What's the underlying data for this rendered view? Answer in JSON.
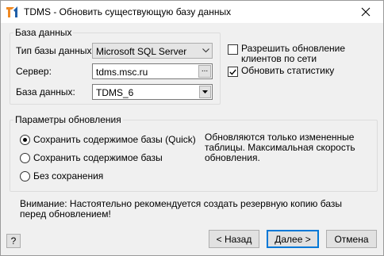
{
  "window": {
    "title": "TDMS - Обновить существующую базу данных"
  },
  "database_group": {
    "legend": "База данных",
    "type_label": "Тип базы данных:",
    "type_value": "Microsoft SQL Server",
    "server_label": "Сервер:",
    "server_value": "tdms.msc.ru",
    "browse_label": "...",
    "db_label": "База данных:",
    "db_value": "TDMS_6"
  },
  "options": {
    "allow_update": {
      "label": "Разрешить обновление клиентов по сети",
      "checked": false
    },
    "update_stats": {
      "label": "Обновить статистику",
      "checked": true
    }
  },
  "update_group": {
    "legend": "Параметры обновления",
    "modes": [
      {
        "label": "Сохранить содержимое базы (Quick)",
        "selected": true
      },
      {
        "label": "Сохранить содержимое базы",
        "selected": false
      },
      {
        "label": "Без сохранения",
        "selected": false
      }
    ],
    "description": "Обновляются только измененные таблицы. Максимальная скорость обновления."
  },
  "warning": "Внимание: Настоятельно рекомендуется создать резервную копию базы перед обновлением!",
  "buttons": {
    "help": "?",
    "back": "< Назад",
    "next": "Далее >",
    "cancel": "Отмена"
  },
  "colors": {
    "accent": "#0078d7",
    "icon_orange": "#f08a24",
    "icon_blue": "#1f5fa8"
  }
}
